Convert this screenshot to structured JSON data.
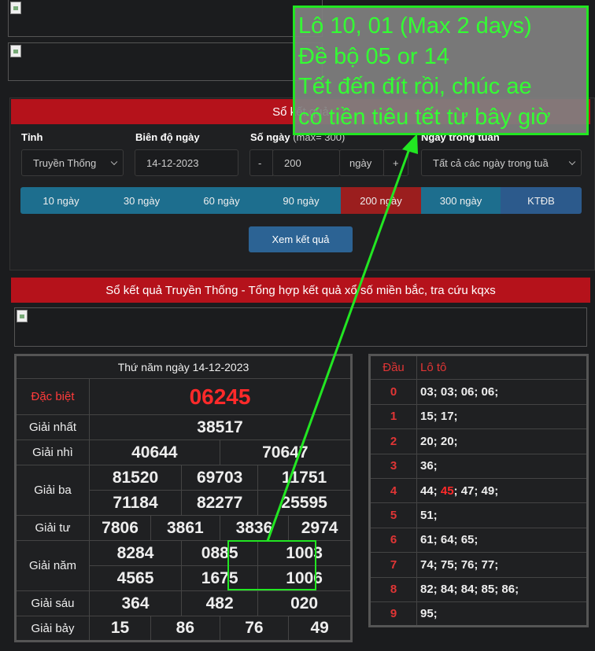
{
  "search_panel": {
    "title": "Sổ kết quả",
    "labels": {
      "province": "Tỉnh",
      "date_range": "Biên độ ngày",
      "days": "Số ngày",
      "days_hint": "(max= 300)",
      "weekday": "Ngày trong tuần"
    },
    "province_value": "Truyền Thống",
    "date_value": "14-12-2023",
    "days_minus": "-",
    "days_value": "200",
    "days_unit": "ngày",
    "days_plus": "+",
    "weekday_value": "Tất cả các ngày trong tuầ",
    "range_buttons": [
      "10 ngày",
      "30 ngày",
      "60 ngày",
      "90 ngày",
      "200 ngày",
      "300 ngày",
      "KTĐB"
    ],
    "active_range": "200 ngày",
    "submit_label": "Xem kết quả"
  },
  "results_header": "Sổ kết quả Truyền Thống - Tổng hợp kết quả xổ số miền bắc, tra cứu kqxs",
  "draw": {
    "date_title": "Thứ năm ngày 14-12-2023",
    "prizes": {
      "special": {
        "name": "Đặc biệt",
        "numbers": [
          "06245"
        ]
      },
      "first": {
        "name": "Giải nhất",
        "numbers": [
          "38517"
        ]
      },
      "second": {
        "name": "Giải nhì",
        "numbers": [
          "40644",
          "70647"
        ]
      },
      "third": {
        "name": "Giải ba",
        "numbers": [
          "81520",
          "69703",
          "11751",
          "71184",
          "82277",
          "25595"
        ]
      },
      "fourth": {
        "name": "Giải tư",
        "numbers": [
          "7806",
          "3861",
          "3836",
          "2974"
        ]
      },
      "fifth": {
        "name": "Giải năm",
        "numbers": [
          "8284",
          "0885",
          "1003",
          "4565",
          "1675",
          "1006"
        ]
      },
      "sixth": {
        "name": "Giải sáu",
        "numbers": [
          "364",
          "482",
          "020"
        ]
      },
      "seventh": {
        "name": "Giải bảy",
        "numbers": [
          "15",
          "86",
          "76",
          "49"
        ]
      }
    }
  },
  "loto_table": {
    "headers": {
      "head": "Đầu",
      "loto": "Lô tô"
    },
    "rows": [
      {
        "head": "0",
        "values": "03; 03; 06; 06;"
      },
      {
        "head": "1",
        "values": "15; 17;"
      },
      {
        "head": "2",
        "values": "20; 20;"
      },
      {
        "head": "3",
        "values": "36;"
      },
      {
        "head": "4",
        "values_before": "44; ",
        "highlight": "45",
        "values_after": "; 47; 49;"
      },
      {
        "head": "5",
        "values": "51;"
      },
      {
        "head": "6",
        "values": "61; 64; 65;"
      },
      {
        "head": "7",
        "values": "74; 75; 76; 77;"
      },
      {
        "head": "8",
        "values": "82; 84; 84; 85; 86;"
      },
      {
        "head": "9",
        "values": "95;"
      }
    ]
  },
  "annotation_note": {
    "lines": [
      "Lô 10, 01 (Max 2 days)",
      "Đề bộ 05 or 14",
      "Tết đến đít rồi, chúc ae",
      "có tiền tiêu tết từ bây giờ"
    ],
    "color": "#33ff33"
  },
  "colors": {
    "accent_red": "#b5121b",
    "special_number": "#ff2a2a",
    "range_button": "#1d6e8e",
    "range_active": "#9b1e1e",
    "ktdb_button": "#2c5a8c"
  }
}
